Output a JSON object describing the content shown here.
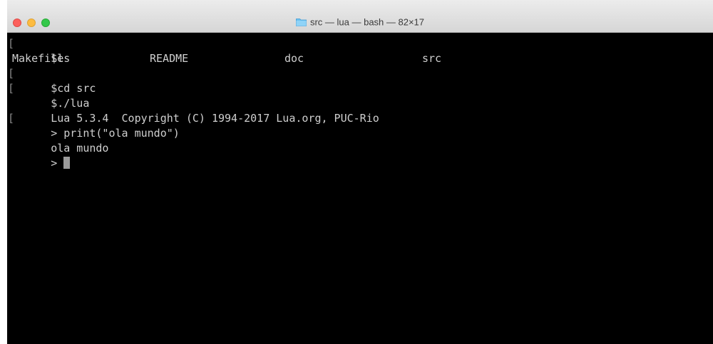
{
  "window": {
    "title": "src — lua — bash — 82×17",
    "folder_icon": "folder-icon",
    "traffic_colors": {
      "close": "#fc605c",
      "minimize": "#fdbc40",
      "maximize": "#34c84a"
    }
  },
  "terminal": {
    "background": "#000000",
    "lines": [
      {
        "mark": "[",
        "text": "$ls"
      },
      {
        "files": [
          "Makefile",
          "README",
          "doc",
          "src"
        ]
      },
      {
        "mark": "[",
        "text": "$cd src"
      },
      {
        "mark": "[",
        "text": "$./lua"
      },
      {
        "text": "Lua 5.3.4  Copyright (C) 1994-2017 Lua.org, PUC-Rio"
      },
      {
        "mark": "[",
        "text": "> print(\"ola mundo\")"
      },
      {
        "text": "ola mundo"
      },
      {
        "text": ">"
      }
    ]
  }
}
